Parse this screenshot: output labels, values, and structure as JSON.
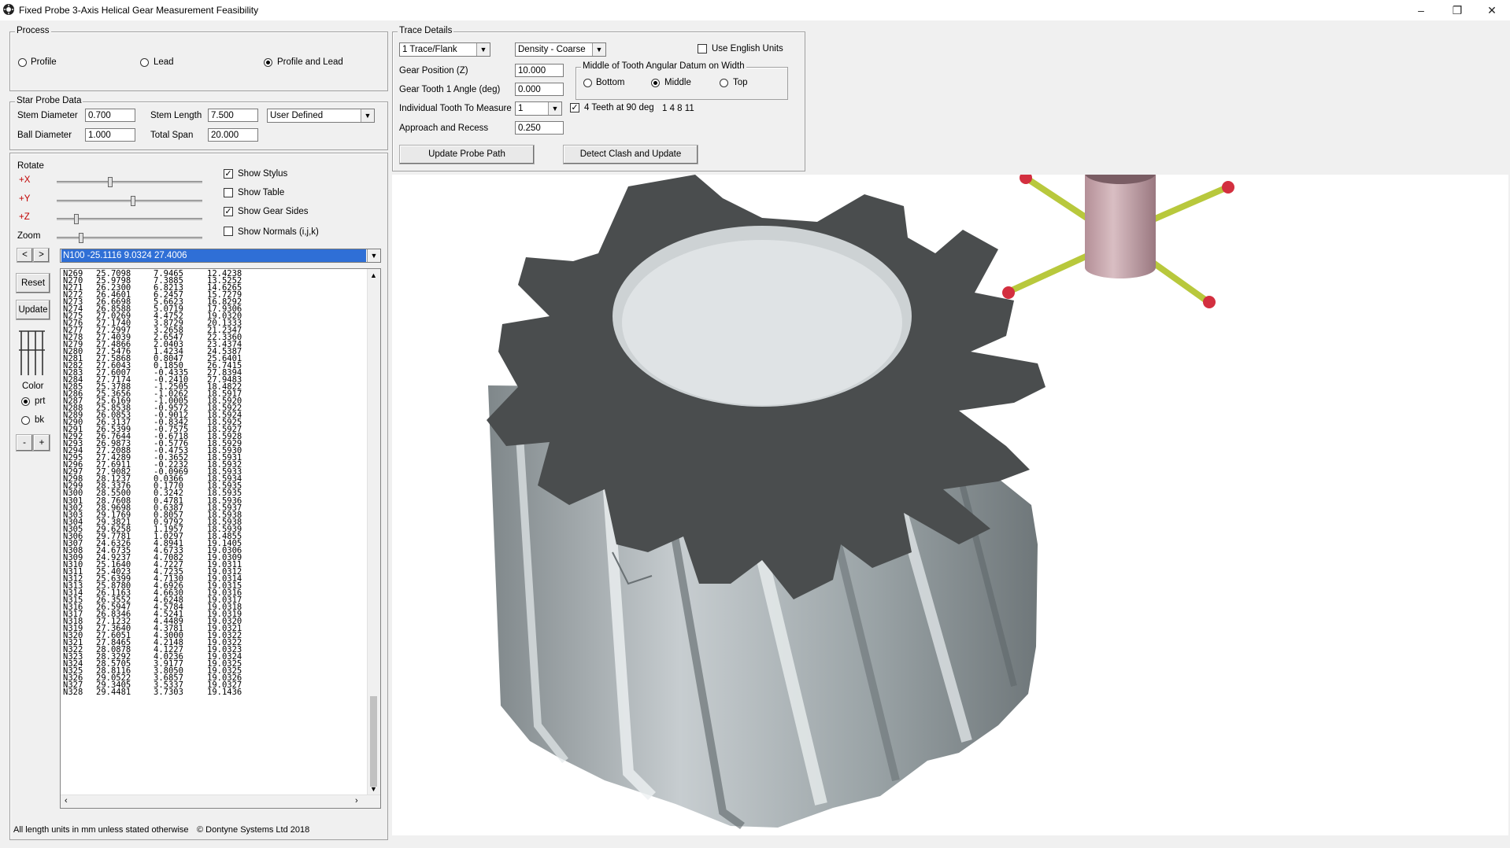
{
  "window": {
    "title": "Fixed Probe 3-Axis Helical Gear Measurement Feasibility"
  },
  "process": {
    "legend": "Process",
    "options": [
      {
        "label": "Profile",
        "selected": false
      },
      {
        "label": "Lead",
        "selected": false
      },
      {
        "label": "Profile and Lead",
        "selected": true
      }
    ]
  },
  "star_probe": {
    "legend": "Star Probe Data",
    "stem_diameter_label": "Stem Diameter",
    "stem_diameter": "0.700",
    "stem_length_label": "Stem Length",
    "stem_length": "7.500",
    "probe_type": "User Defined",
    "ball_diameter_label": "Ball Diameter",
    "ball_diameter": "1.000",
    "total_span_label": "Total Span",
    "total_span": "20.000"
  },
  "view": {
    "rotate_label": "Rotate",
    "x_label": "+X",
    "y_label": "+Y",
    "z_label": "+Z",
    "zoom_label": "Zoom",
    "show_stylus": "Show Stylus",
    "show_table": "Show Table",
    "show_gear_sides": "Show Gear Sides",
    "show_normals": "Show Normals (i,j,k)",
    "prev": "<",
    "next": ">",
    "point_select": "N100  -25.1116  9.0324   27.4006",
    "reset": "Reset",
    "update": "Update",
    "color_label": "Color",
    "color_prt": "prt",
    "color_bk": "bk",
    "minus": "-",
    "plus": "+"
  },
  "points": [
    [
      "N269",
      "25.7098",
      "7.9465",
      "12.4238"
    ],
    [
      "N270",
      "25.9798",
      "7.3885",
      "13.5252"
    ],
    [
      "N271",
      "26.2300",
      "6.8213",
      "14.6265"
    ],
    [
      "N272",
      "26.4601",
      "6.2457",
      "15.7279"
    ],
    [
      "N273",
      "26.6698",
      "5.6623",
      "16.8292"
    ],
    [
      "N274",
      "26.8588",
      "5.0719",
      "17.9306"
    ],
    [
      "N275",
      "27.0269",
      "4.4752",
      "19.0320"
    ],
    [
      "N276",
      "27.1740",
      "3.8729",
      "20.1333"
    ],
    [
      "N277",
      "27.2997",
      "3.2658",
      "21.2347"
    ],
    [
      "N278",
      "27.4039",
      "2.6547",
      "22.3360"
    ],
    [
      "N279",
      "27.4866",
      "2.0403",
      "23.4374"
    ],
    [
      "N280",
      "27.5476",
      "1.4234",
      "24.5387"
    ],
    [
      "N281",
      "27.5868",
      "0.8047",
      "25.6401"
    ],
    [
      "N282",
      "27.6043",
      "0.1850",
      "26.7415"
    ],
    [
      "N283",
      "27.6007",
      "-0.4335",
      "27.8394"
    ],
    [
      "N284",
      "27.7174",
      "-0.2410",
      "27.9483"
    ],
    [
      "N285",
      "25.3788",
      "-1.2505",
      "18.4822"
    ],
    [
      "N286",
      "25.3656",
      "-1.0262",
      "18.5917"
    ],
    [
      "N287",
      "25.6169",
      "-1.0005",
      "18.5920"
    ],
    [
      "N288",
      "25.8538",
      "-0.9572",
      "18.5922"
    ],
    [
      "N289",
      "26.0853",
      "-0.9012",
      "18.5924"
    ],
    [
      "N290",
      "26.3137",
      "-0.8342",
      "18.5925"
    ],
    [
      "N291",
      "26.5399",
      "-0.7575",
      "18.5927"
    ],
    [
      "N292",
      "26.7644",
      "-0.6718",
      "18.5928"
    ],
    [
      "N293",
      "26.9873",
      "-0.5776",
      "18.5929"
    ],
    [
      "N294",
      "27.2088",
      "-0.4753",
      "18.5930"
    ],
    [
      "N295",
      "27.4289",
      "-0.3652",
      "18.5931"
    ],
    [
      "N296",
      "27.6911",
      "-0.2232",
      "18.5932"
    ],
    [
      "N297",
      "27.9082",
      "-0.0969",
      "18.5933"
    ],
    [
      "N298",
      "28.1237",
      "0.0366",
      "18.5934"
    ],
    [
      "N299",
      "28.3376",
      "0.1770",
      "18.5935"
    ],
    [
      "N300",
      "28.5500",
      "0.3242",
      "18.5935"
    ],
    [
      "N301",
      "28.7608",
      "0.4781",
      "18.5936"
    ],
    [
      "N302",
      "28.9698",
      "0.6387",
      "18.5937"
    ],
    [
      "N303",
      "29.1769",
      "0.8057",
      "18.5938"
    ],
    [
      "N304",
      "29.3821",
      "0.9792",
      "18.5938"
    ],
    [
      "N305",
      "29.6258",
      "1.1957",
      "18.5939"
    ],
    [
      "N306",
      "29.7781",
      "1.0297",
      "18.4855"
    ],
    [
      "N307",
      "24.6326",
      "4.8941",
      "19.1405"
    ],
    [
      "N308",
      "24.6735",
      "4.6733",
      "19.0306"
    ],
    [
      "N309",
      "24.9237",
      "4.7082",
      "19.0309"
    ],
    [
      "N310",
      "25.1640",
      "4.7227",
      "19.0311"
    ],
    [
      "N311",
      "25.4023",
      "4.7235",
      "19.0312"
    ],
    [
      "N312",
      "25.6399",
      "4.7130",
      "19.0314"
    ],
    [
      "N313",
      "25.8780",
      "4.6926",
      "19.0315"
    ],
    [
      "N314",
      "26.1163",
      "4.6630",
      "19.0316"
    ],
    [
      "N315",
      "26.3552",
      "4.6248",
      "19.0317"
    ],
    [
      "N316",
      "26.5947",
      "4.5784",
      "19.0318"
    ],
    [
      "N317",
      "26.8346",
      "4.5241",
      "19.0319"
    ],
    [
      "N318",
      "27.1232",
      "4.4489",
      "19.0320"
    ],
    [
      "N319",
      "27.3640",
      "4.3781",
      "19.0321"
    ],
    [
      "N320",
      "27.6051",
      "4.3000",
      "19.0322"
    ],
    [
      "N321",
      "27.8465",
      "4.2148",
      "19.0322"
    ],
    [
      "N322",
      "28.0878",
      "4.1227",
      "19.0323"
    ],
    [
      "N323",
      "28.3292",
      "4.0236",
      "19.0324"
    ],
    [
      "N324",
      "28.5705",
      "3.9177",
      "19.0325"
    ],
    [
      "N325",
      "28.8116",
      "3.8050",
      "19.0325"
    ],
    [
      "N326",
      "29.0522",
      "3.6857",
      "19.0326"
    ],
    [
      "N327",
      "29.3405",
      "3.5337",
      "19.0327"
    ],
    [
      "N328",
      "29.4481",
      "3.7303",
      "19.1436"
    ]
  ],
  "status": {
    "units_note": "All length units in mm unless stated otherwise",
    "copyright": "© Dontyne Systems Ltd 2018"
  },
  "trace": {
    "legend": "Trace Details",
    "traces": "1 Trace/Flank",
    "density": "Density - Coarse",
    "english_units": "Use English Units",
    "gear_position_label": "Gear Position (Z)",
    "gear_position": "10.000",
    "gear_tooth_angle_label": "Gear Tooth 1 Angle (deg)",
    "gear_tooth_angle": "0.000",
    "individual_tooth_label": "Individual Tooth To Measure",
    "individual_tooth": "1",
    "four_teeth_label": "4 Teeth at 90 deg",
    "teeth_list": "1  4  8  11",
    "approach_label": "Approach and Recess",
    "approach": "0.250",
    "datum_legend": "Middle of Tooth Angular Datum on Width",
    "datum_options": [
      {
        "label": "Bottom",
        "selected": false
      },
      {
        "label": "Middle",
        "selected": true
      },
      {
        "label": "Top",
        "selected": false
      }
    ],
    "update_path": "Update Probe Path",
    "detect_clash": "Detect Clash and Update"
  },
  "colors": {
    "gear_top": "#4a4d4e",
    "gear_side": "#a9b1b4",
    "stem": "#c8a9af",
    "probe_arm": "#b8c83c",
    "ball": "#d32f3f",
    "highlight": "#3a7bd5"
  }
}
